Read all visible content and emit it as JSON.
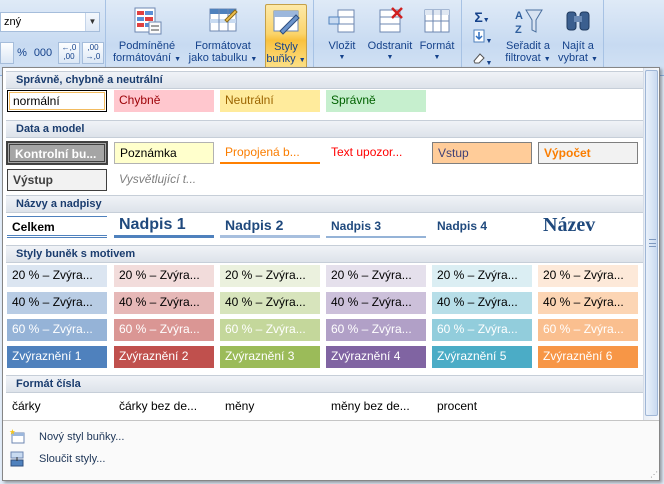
{
  "ribbon": {
    "font_value": "zný",
    "number_format_buttons": [
      "%",
      "000",
      "←,0 ,00",
      ",00 →,0"
    ],
    "conditional_label": [
      "Podmíněné",
      "formátování"
    ],
    "format_table_label": [
      "Formátovat",
      "jako tabulku"
    ],
    "cell_styles_label": [
      "Styly",
      "buňky"
    ],
    "insert_label": "Vložit",
    "delete_label": "Odstranit",
    "format_label": "Formát",
    "sigma": "Σ",
    "sort_label": [
      "Seřadit a",
      "filtrovat"
    ],
    "find_label": [
      "Najít a",
      "vybrat"
    ]
  },
  "gallery": {
    "sections": [
      {
        "title": "Správně, chybně a neutrální",
        "rows": [
          [
            {
              "text": "normální",
              "style": "normal"
            },
            {
              "text": "Chybně",
              "style": "bad"
            },
            {
              "text": "Neutrální",
              "style": "neutral"
            },
            {
              "text": "Správně",
              "style": "good"
            }
          ]
        ]
      },
      {
        "title": "Data a model",
        "rows": [
          [
            {
              "text": "Kontrolní bu...",
              "style": "check"
            },
            {
              "text": "Poznámka",
              "style": "note"
            },
            {
              "text": "Propojená b...",
              "style": "linked"
            },
            {
              "text": "Text upozor...",
              "style": "warning"
            },
            {
              "text": "Vstup",
              "style": "input"
            },
            {
              "text": "Výpočet",
              "style": "calc"
            }
          ],
          [
            {
              "text": "Výstup",
              "style": "output"
            },
            {
              "text": "Vysvětlující t...",
              "style": "explain"
            }
          ]
        ]
      },
      {
        "title": "Názvy a nadpisy",
        "rows": [
          [
            {
              "text": "Celkem",
              "style": "total"
            },
            {
              "text": "Nadpis 1",
              "style": "h1"
            },
            {
              "text": "Nadpis 2",
              "style": "h2"
            },
            {
              "text": "Nadpis 3",
              "style": "h3"
            },
            {
              "text": "Nadpis 4",
              "style": "h4"
            },
            {
              "text": "Název",
              "style": "title"
            }
          ]
        ]
      },
      {
        "title": "Styly buněk s motivem",
        "rows": [
          [
            {
              "text": "20 % – Zvýra...",
              "style": "a20-1"
            },
            {
              "text": "20 % – Zvýra...",
              "style": "a20-2"
            },
            {
              "text": "20 % – Zvýra...",
              "style": "a20-3"
            },
            {
              "text": "20 % – Zvýra...",
              "style": "a20-4"
            },
            {
              "text": "20 % – Zvýra...",
              "style": "a20-5"
            },
            {
              "text": "20 % – Zvýra...",
              "style": "a20-6"
            }
          ],
          [
            {
              "text": "40 % – Zvýra...",
              "style": "a40-1"
            },
            {
              "text": "40 % – Zvýra...",
              "style": "a40-2"
            },
            {
              "text": "40 % – Zvýra...",
              "style": "a40-3"
            },
            {
              "text": "40 % – Zvýra...",
              "style": "a40-4"
            },
            {
              "text": "40 % – Zvýra...",
              "style": "a40-5"
            },
            {
              "text": "40 % – Zvýra...",
              "style": "a40-6"
            }
          ],
          [
            {
              "text": "60 % – Zvýra...",
              "style": "a60-1"
            },
            {
              "text": "60 % – Zvýra...",
              "style": "a60-2"
            },
            {
              "text": "60 % – Zvýra...",
              "style": "a60-3"
            },
            {
              "text": "60 % – Zvýra...",
              "style": "a60-4"
            },
            {
              "text": "60 % – Zvýra...",
              "style": "a60-5"
            },
            {
              "text": "60 % – Zvýra...",
              "style": "a60-6"
            }
          ],
          [
            {
              "text": "Zvýraznění 1",
              "style": "acc-1"
            },
            {
              "text": "Zvýraznění 2",
              "style": "acc-2"
            },
            {
              "text": "Zvýraznění 3",
              "style": "acc-3"
            },
            {
              "text": "Zvýraznění 4",
              "style": "acc-4"
            },
            {
              "text": "Zvýraznění 5",
              "style": "acc-5"
            },
            {
              "text": "Zvýraznění 6",
              "style": "acc-6"
            }
          ]
        ]
      },
      {
        "title": "Formát čísla",
        "rows": [
          [
            {
              "text": "čárky",
              "style": "plain"
            },
            {
              "text": "čárky bez de...",
              "style": "plain"
            },
            {
              "text": "měny",
              "style": "plain"
            },
            {
              "text": "měny bez de...",
              "style": "plain"
            },
            {
              "text": "procent",
              "style": "plain"
            }
          ]
        ]
      }
    ],
    "footer": [
      {
        "label": "Nový styl buňky...",
        "icon": "new-style-icon"
      },
      {
        "label": "Sloučit styly...",
        "icon": "merge-styles-icon"
      }
    ]
  },
  "colors": {
    "accent1": "#4f81bd",
    "accent2": "#c0504d",
    "accent3": "#9bbb59",
    "accent4": "#8064a2",
    "accent5": "#4bacc6",
    "accent6": "#f79646"
  }
}
